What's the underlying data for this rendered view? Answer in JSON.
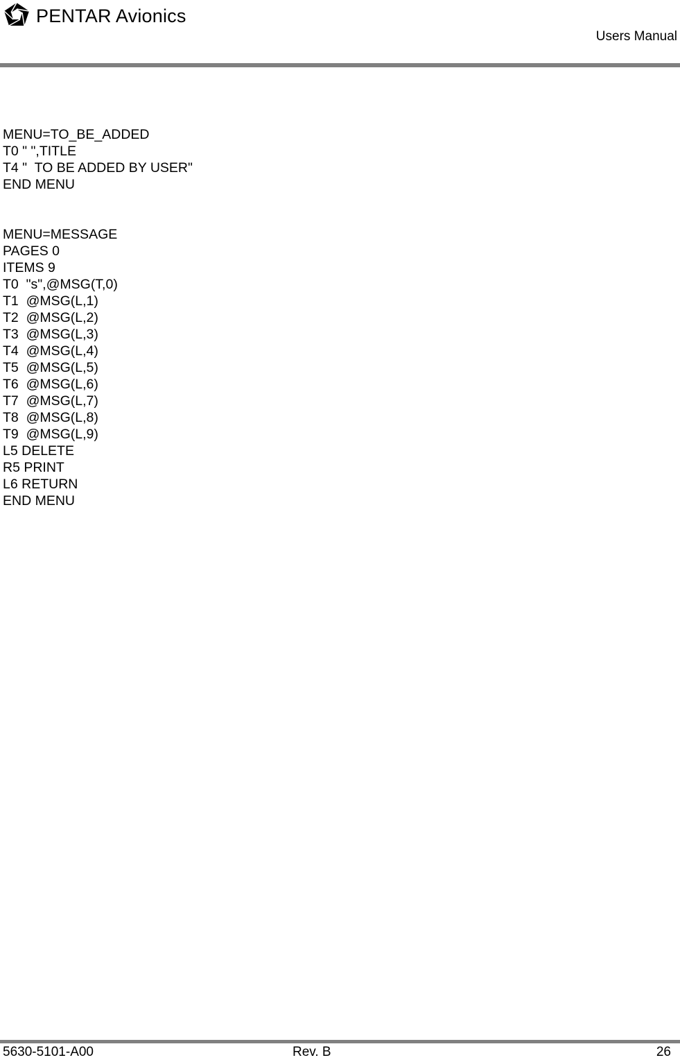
{
  "header": {
    "brand": "PENTAR Avionics",
    "logo_icon": "pentagon-shutter-logo",
    "document_title": "Users Manual"
  },
  "content": {
    "blocks": [
      {
        "lines": [
          "MENU=TO_BE_ADDED",
          "T0 \" \",TITLE",
          "T4 \"  TO BE ADDED BY USER\"",
          "END MENU"
        ]
      },
      {
        "lines": [
          "MENU=MESSAGE",
          "PAGES 0",
          "ITEMS 9",
          "T0  \"s\",@MSG(T,0)",
          "T1  @MSG(L,1)",
          "T2  @MSG(L,2)",
          "T3  @MSG(L,3)",
          "T4  @MSG(L,4)",
          "T5  @MSG(L,5)",
          "T6  @MSG(L,6)",
          "T7  @MSG(L,7)",
          "T8  @MSG(L,8)",
          "T9  @MSG(L,9)",
          "L5 DELETE",
          "R5 PRINT",
          "L6 RETURN",
          "END MENU"
        ]
      }
    ]
  },
  "footer": {
    "doc_number": "5630-5101-A00",
    "revision": "Rev. B",
    "page_number": "26"
  },
  "colors": {
    "rule": "#808080",
    "text": "#000000"
  }
}
